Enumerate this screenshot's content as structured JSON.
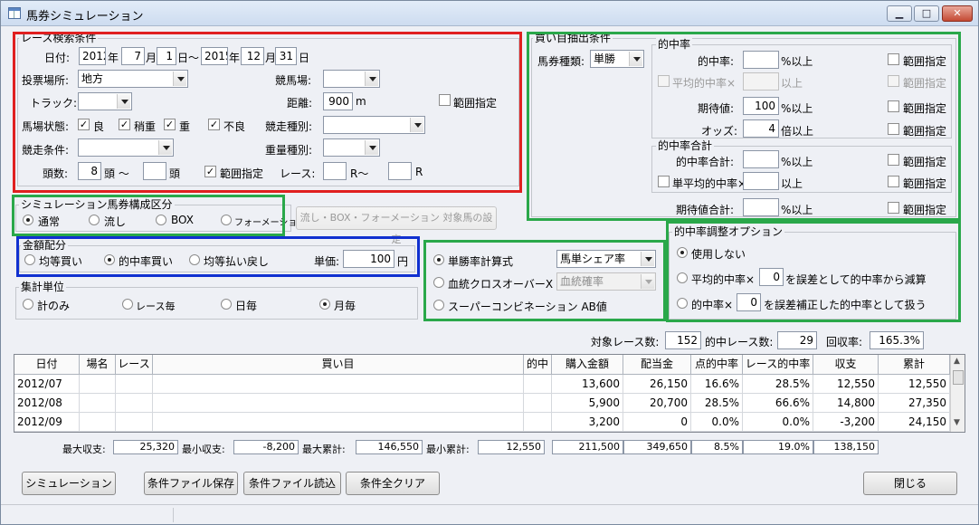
{
  "window": {
    "title": "馬券シミュレーション",
    "min": "▁",
    "max": "□",
    "close": "✕"
  },
  "race": {
    "title": "レース検索条件",
    "date_label": "日付:",
    "from_year": "2012",
    "year1": "年",
    "from_month": "7",
    "month1": "月",
    "from_day": "1",
    "tilde_day": "日～",
    "to_year": "2015",
    "year2": "年",
    "to_month": "12",
    "month2": "月",
    "to_day": "31",
    "day2": "日",
    "venue_label": "投票場所:",
    "venue_value": "地方",
    "track_name_label": "競馬場:",
    "track_label": "トラック:",
    "distance_label": "距離:",
    "distance_value": "900",
    "distance_unit": "m",
    "distance_range": "範囲指定",
    "condition_label": "馬場状態:",
    "cond_good": "良",
    "cond_slightly": "稍重",
    "cond_heavy": "重",
    "cond_bad": "不良",
    "race_type_label": "競走種別:",
    "entry_label": "競走条件:",
    "weight_type_label": "重量種別:",
    "heads_label": "頭数:",
    "heads_from": "8",
    "heads_unit1": "頭 ～",
    "heads_unit2": "頭",
    "heads_range": "範囲指定",
    "race_label": "レース:",
    "race_unit1": "R～",
    "race_unit2": "R"
  },
  "pick": {
    "title": "買い目抽出条件",
    "ticket_type_label": "馬券種類:",
    "ticket_type_value": "単勝",
    "hit_title": "的中率",
    "hit_label": "的中率:",
    "hit_unit": "%以上",
    "avg_hit_label": "平均的中率×",
    "avg_hit_unit": "以上",
    "exp_label": "期待値:",
    "exp_value": "100",
    "exp_unit": "%以上",
    "odds_label": "オッズ:",
    "odds_value": "4",
    "odds_unit": "倍以上",
    "sum_title": "的中率合計",
    "sum_hit_label": "的中率合計:",
    "sum_hit_unit": "%以上",
    "single_avg_label": "単平均的中率×",
    "single_avg_unit": "以上",
    "exp_sum_label": "期待値合計:",
    "exp_sum_unit": "%以上",
    "range": "範囲指定"
  },
  "composition": {
    "title": "シミュレーション馬券構成区分",
    "opts": [
      "通常",
      "流し",
      "BOX",
      "フォーメーション"
    ],
    "target_button": "流し・BOX・フォーメーション 対象馬の設定"
  },
  "money": {
    "title": "金額配分",
    "opts": [
      "均等買い",
      "的中率買い",
      "均等払い戻し"
    ],
    "unit_label": "単価:",
    "unit_value": "100",
    "unit_yen": "円"
  },
  "calc": {
    "win_rate_label": "単勝率計算式",
    "win_rate_value": "馬単シェア率",
    "blood_label": "血統クロスオーバーX",
    "blood_value": "血統確率",
    "super_label": "スーパーコンビネーション AB値"
  },
  "adjust": {
    "title": "的中率調整オプション",
    "opt1": "使用しない",
    "opt2_pre": "平均的中率×",
    "opt2_val": "0",
    "opt2_post": "を誤差として的中率から減算",
    "opt3_pre": "的中率×",
    "opt3_val": "0",
    "opt3_post": "を誤差補正した的中率として扱う"
  },
  "unit": {
    "title": "集計単位",
    "opts": [
      "計のみ",
      "レース毎",
      "日毎",
      "月毎"
    ]
  },
  "stats": {
    "target_label": "対象レース数:",
    "target_value": "152",
    "hit_label": "的中レース数:",
    "hit_value": "29",
    "return_label": "回収率:",
    "return_value": "165.3%"
  },
  "table": {
    "headers": [
      "日付",
      "場名",
      "レース",
      "買い目",
      "的中",
      "購入金額",
      "配当金",
      "点的中率",
      "レース的中率",
      "収支",
      "累計"
    ],
    "rows": [
      [
        "2012/07",
        "",
        "",
        "",
        "",
        "13,600",
        "26,150",
        "16.6%",
        "28.5%",
        "12,550",
        "12,550"
      ],
      [
        "2012/08",
        "",
        "",
        "",
        "",
        "5,900",
        "20,700",
        "28.5%",
        "66.6%",
        "14,800",
        "27,350"
      ],
      [
        "2012/09",
        "",
        "",
        "",
        "",
        "3,200",
        "0",
        "0.0%",
        "0.0%",
        "-3,200",
        "24,150"
      ]
    ]
  },
  "summary": {
    "max_income_label": "最大収支:",
    "max_income": "25,320",
    "min_income_label": "最小収支:",
    "min_income": "-8,200",
    "max_cum_label": "最大累計:",
    "max_cum": "146,550",
    "min_cum_label": "最小累計:",
    "min_cum": "12,550",
    "total_buy": "211,500",
    "total_pay": "349,650",
    "pt_rate": "8.5%",
    "race_rate": "19.0%",
    "total_income": "138,150"
  },
  "buttons": {
    "simulate": "シミュレーション",
    "save": "条件ファイル保存",
    "load": "条件ファイル読込",
    "clear": "条件全クリア",
    "close": "閉じる"
  },
  "colors": {
    "red": "#e02020",
    "green": "#2aa84a",
    "blue": "#1030d0"
  },
  "scroll": {
    "up": "▲",
    "down": "▼"
  }
}
